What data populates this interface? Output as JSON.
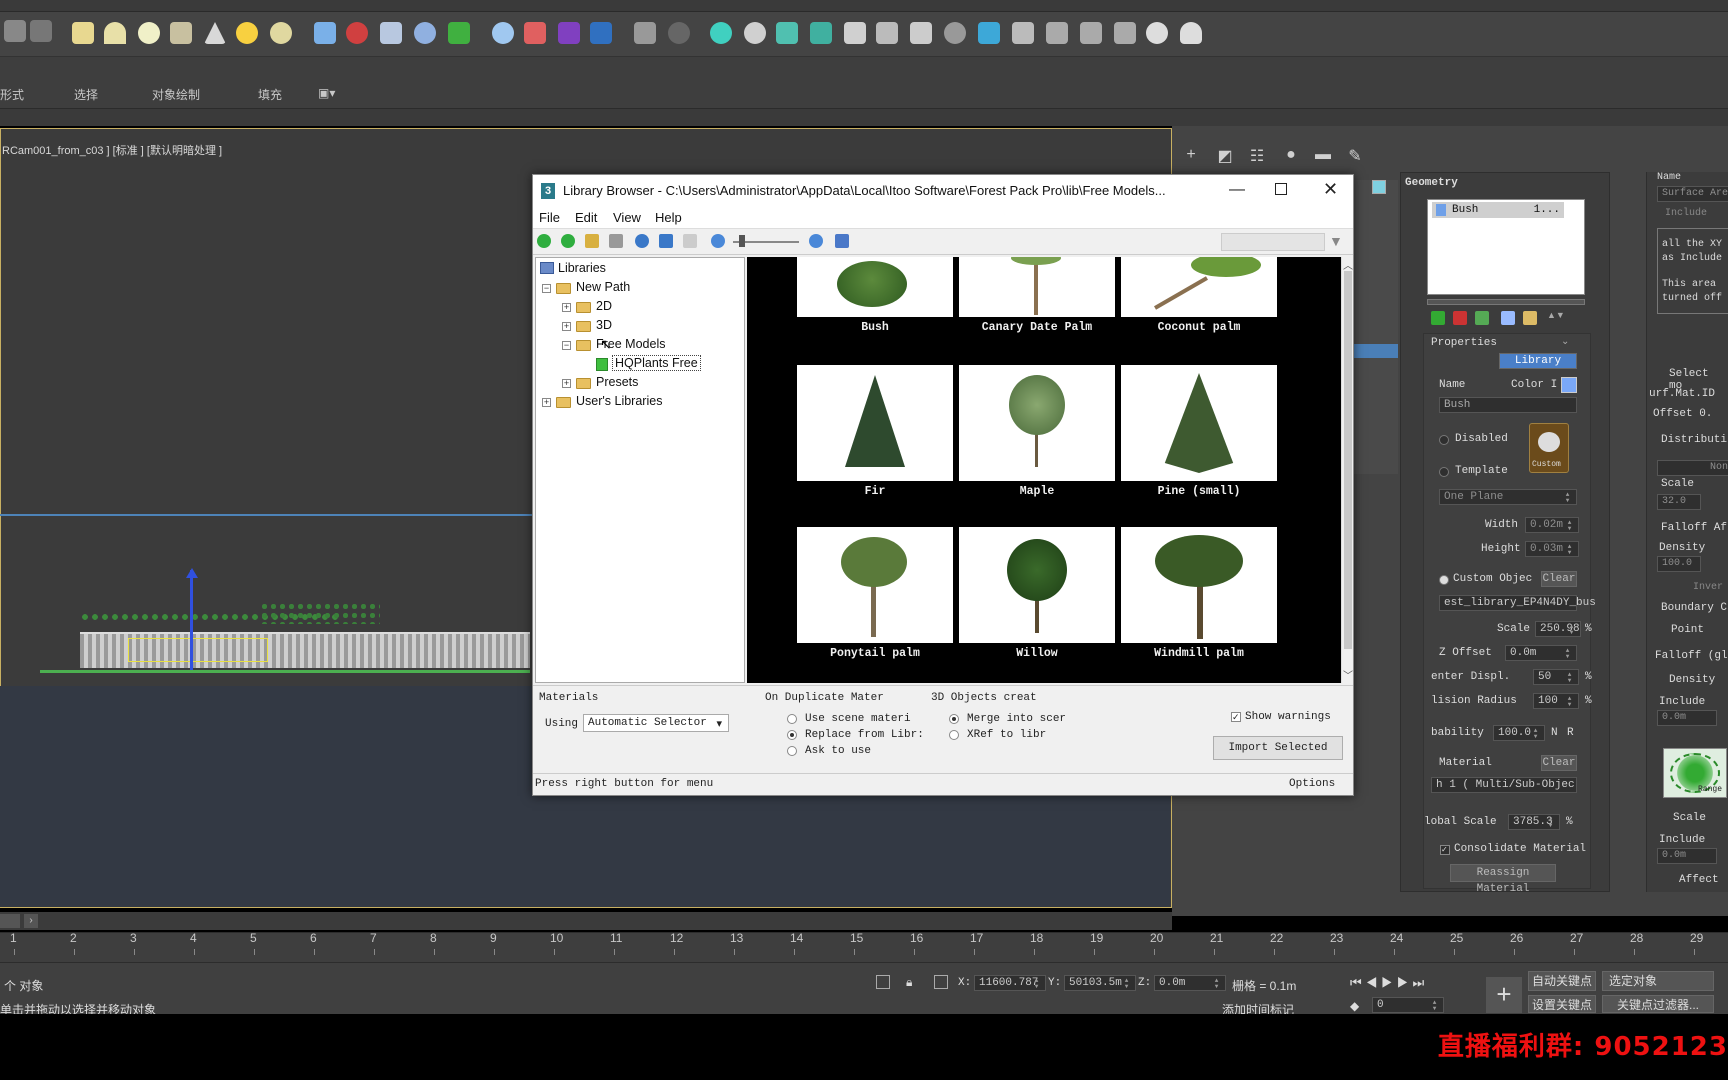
{
  "ribbon": {
    "tabs": [
      "形式",
      "选择",
      "对象绘制",
      "填充"
    ]
  },
  "viewport": {
    "label": "RCam001_from_c03 ] [标准 ] [默认明暗处理 ]"
  },
  "library": {
    "title": "Library Browser - C:\\Users\\Administrator\\AppData\\Local\\Itoo Software\\Forest Pack Pro\\lib\\Free Models...",
    "menu": [
      "File",
      "Edit",
      "View",
      "Help"
    ],
    "tree": {
      "root": "Libraries",
      "new_path": "New Path",
      "items": [
        "2D",
        "3D",
        "Free Models",
        "HQPlants Free",
        "Presets"
      ],
      "user_libraries": "User's Libraries"
    },
    "thumbs": [
      "Bush",
      "Canary Date Palm",
      "Coconut palm",
      "Fir",
      "Maple",
      "Pine (small)",
      "Ponytail palm",
      "Willow",
      "Windmill palm"
    ],
    "bottom": {
      "materials_label": "Materials",
      "using_label": "Using",
      "using_value": "Automatic Selector",
      "dup_label": "On Duplicate Mater",
      "dup_options": [
        "Use scene materi",
        "Replace from Libr:",
        "Ask to use"
      ],
      "objects_label": "3D Objects creat",
      "object_options": [
        "Merge into scer",
        "XRef to libr"
      ],
      "show_warnings": "Show warnings",
      "import_button": "Import Selected"
    },
    "status_text": "Press right button for menu",
    "options_label": "Options"
  },
  "geometry": {
    "header": "Geometry",
    "list_item": "Bush",
    "list_item_count": "1...",
    "properties_header": "Properties",
    "library_button": "Library",
    "name_label": "Name",
    "color_label": "Color I",
    "name_value": "Bush",
    "disabled_label": "Disabled",
    "template_label": "Template",
    "plane_value": "One Plane",
    "width_label": "Width",
    "width_value": "0.02m",
    "height_label": "Height",
    "height_value": "0.03m",
    "custom_object_label": "Custom Objec",
    "clear_label": "Clear",
    "custom_icon_label": "Custom",
    "custom_path": "est_library_EP4N4DY_bus",
    "scale_label": "Scale",
    "scale_value": "250.98",
    "pct": "%",
    "zoffset_label": "Z Offset",
    "zoffset_value": "0.0m",
    "center_disp_label": "enter Displ.",
    "center_disp_value": "50",
    "collision_label": "lision Radius",
    "collision_value": "100",
    "probability_label": "bability",
    "probability_value": "100.0",
    "n_label": "N",
    "r_label": "R",
    "material_label": "Material",
    "material_clear": "Clear",
    "material_value": "h 1  ( Multi/Sub-Objec",
    "global_scale_label": "lobal Scale",
    "global_scale_value": "3785.3",
    "consolidate_label": "Consolidate Material",
    "reassign_label": "Reassign Material"
  },
  "far_right": {
    "name": "Name",
    "surface_area": "Surface Are",
    "include": "Include",
    "desc1": "all the XY",
    "desc2": "as Include",
    "desc3": "This area",
    "desc4": "turned off",
    "select_mod": "Select mo",
    "surf_mat": "urf.Mat.ID",
    "offset": "Offset 0.",
    "distribution": "Distributi",
    "none": "Non",
    "scale": "Scale",
    "scale_value": "32.0",
    "falloff_a": "Falloff Af",
    "density": "Density",
    "density_value": "100.0",
    "invert": "Inver",
    "boundary": "Boundary C",
    "point": "Point",
    "falloff_gl": "Falloff (gl",
    "density2": "Density",
    "include2": "Include",
    "include_value": "0.0m",
    "scale2": "Scale",
    "include3": "Include",
    "include3_value": "0.0m",
    "affect": "Affect",
    "range_label": "Range"
  },
  "timeline": {
    "ticks": [
      "1",
      "2",
      "3",
      "4",
      "5",
      "6",
      "7",
      "8",
      "9",
      "10",
      "11",
      "12",
      "13",
      "14",
      "15",
      "16",
      "17",
      "18",
      "19",
      "20",
      "21",
      "22",
      "23",
      "24",
      "25",
      "26",
      "27",
      "28",
      "29"
    ]
  },
  "status": {
    "objects_label": "个 对象",
    "hint": "单击并拖动以选择并移动对象",
    "x_label": "X:",
    "x_value": "11600.787",
    "y_label": "Y:",
    "y_value": "50103.5m",
    "z_label": "Z:",
    "z_value": "0.0m",
    "grid": "栅格 = 0.1m",
    "add_time_tag": "添加时间标记",
    "auto_key": "自动关键点",
    "selected_object": "选定对象",
    "set_key": "设置关键点",
    "key_filter": "关键点过滤器...",
    "frame_value": "0"
  },
  "promo": "直播福利群: 9052123",
  "colors": {
    "panel_bg": "#444444",
    "viewport_border": "#c8b062",
    "horizon": "#4d83b8",
    "promo": "#ee1111"
  }
}
